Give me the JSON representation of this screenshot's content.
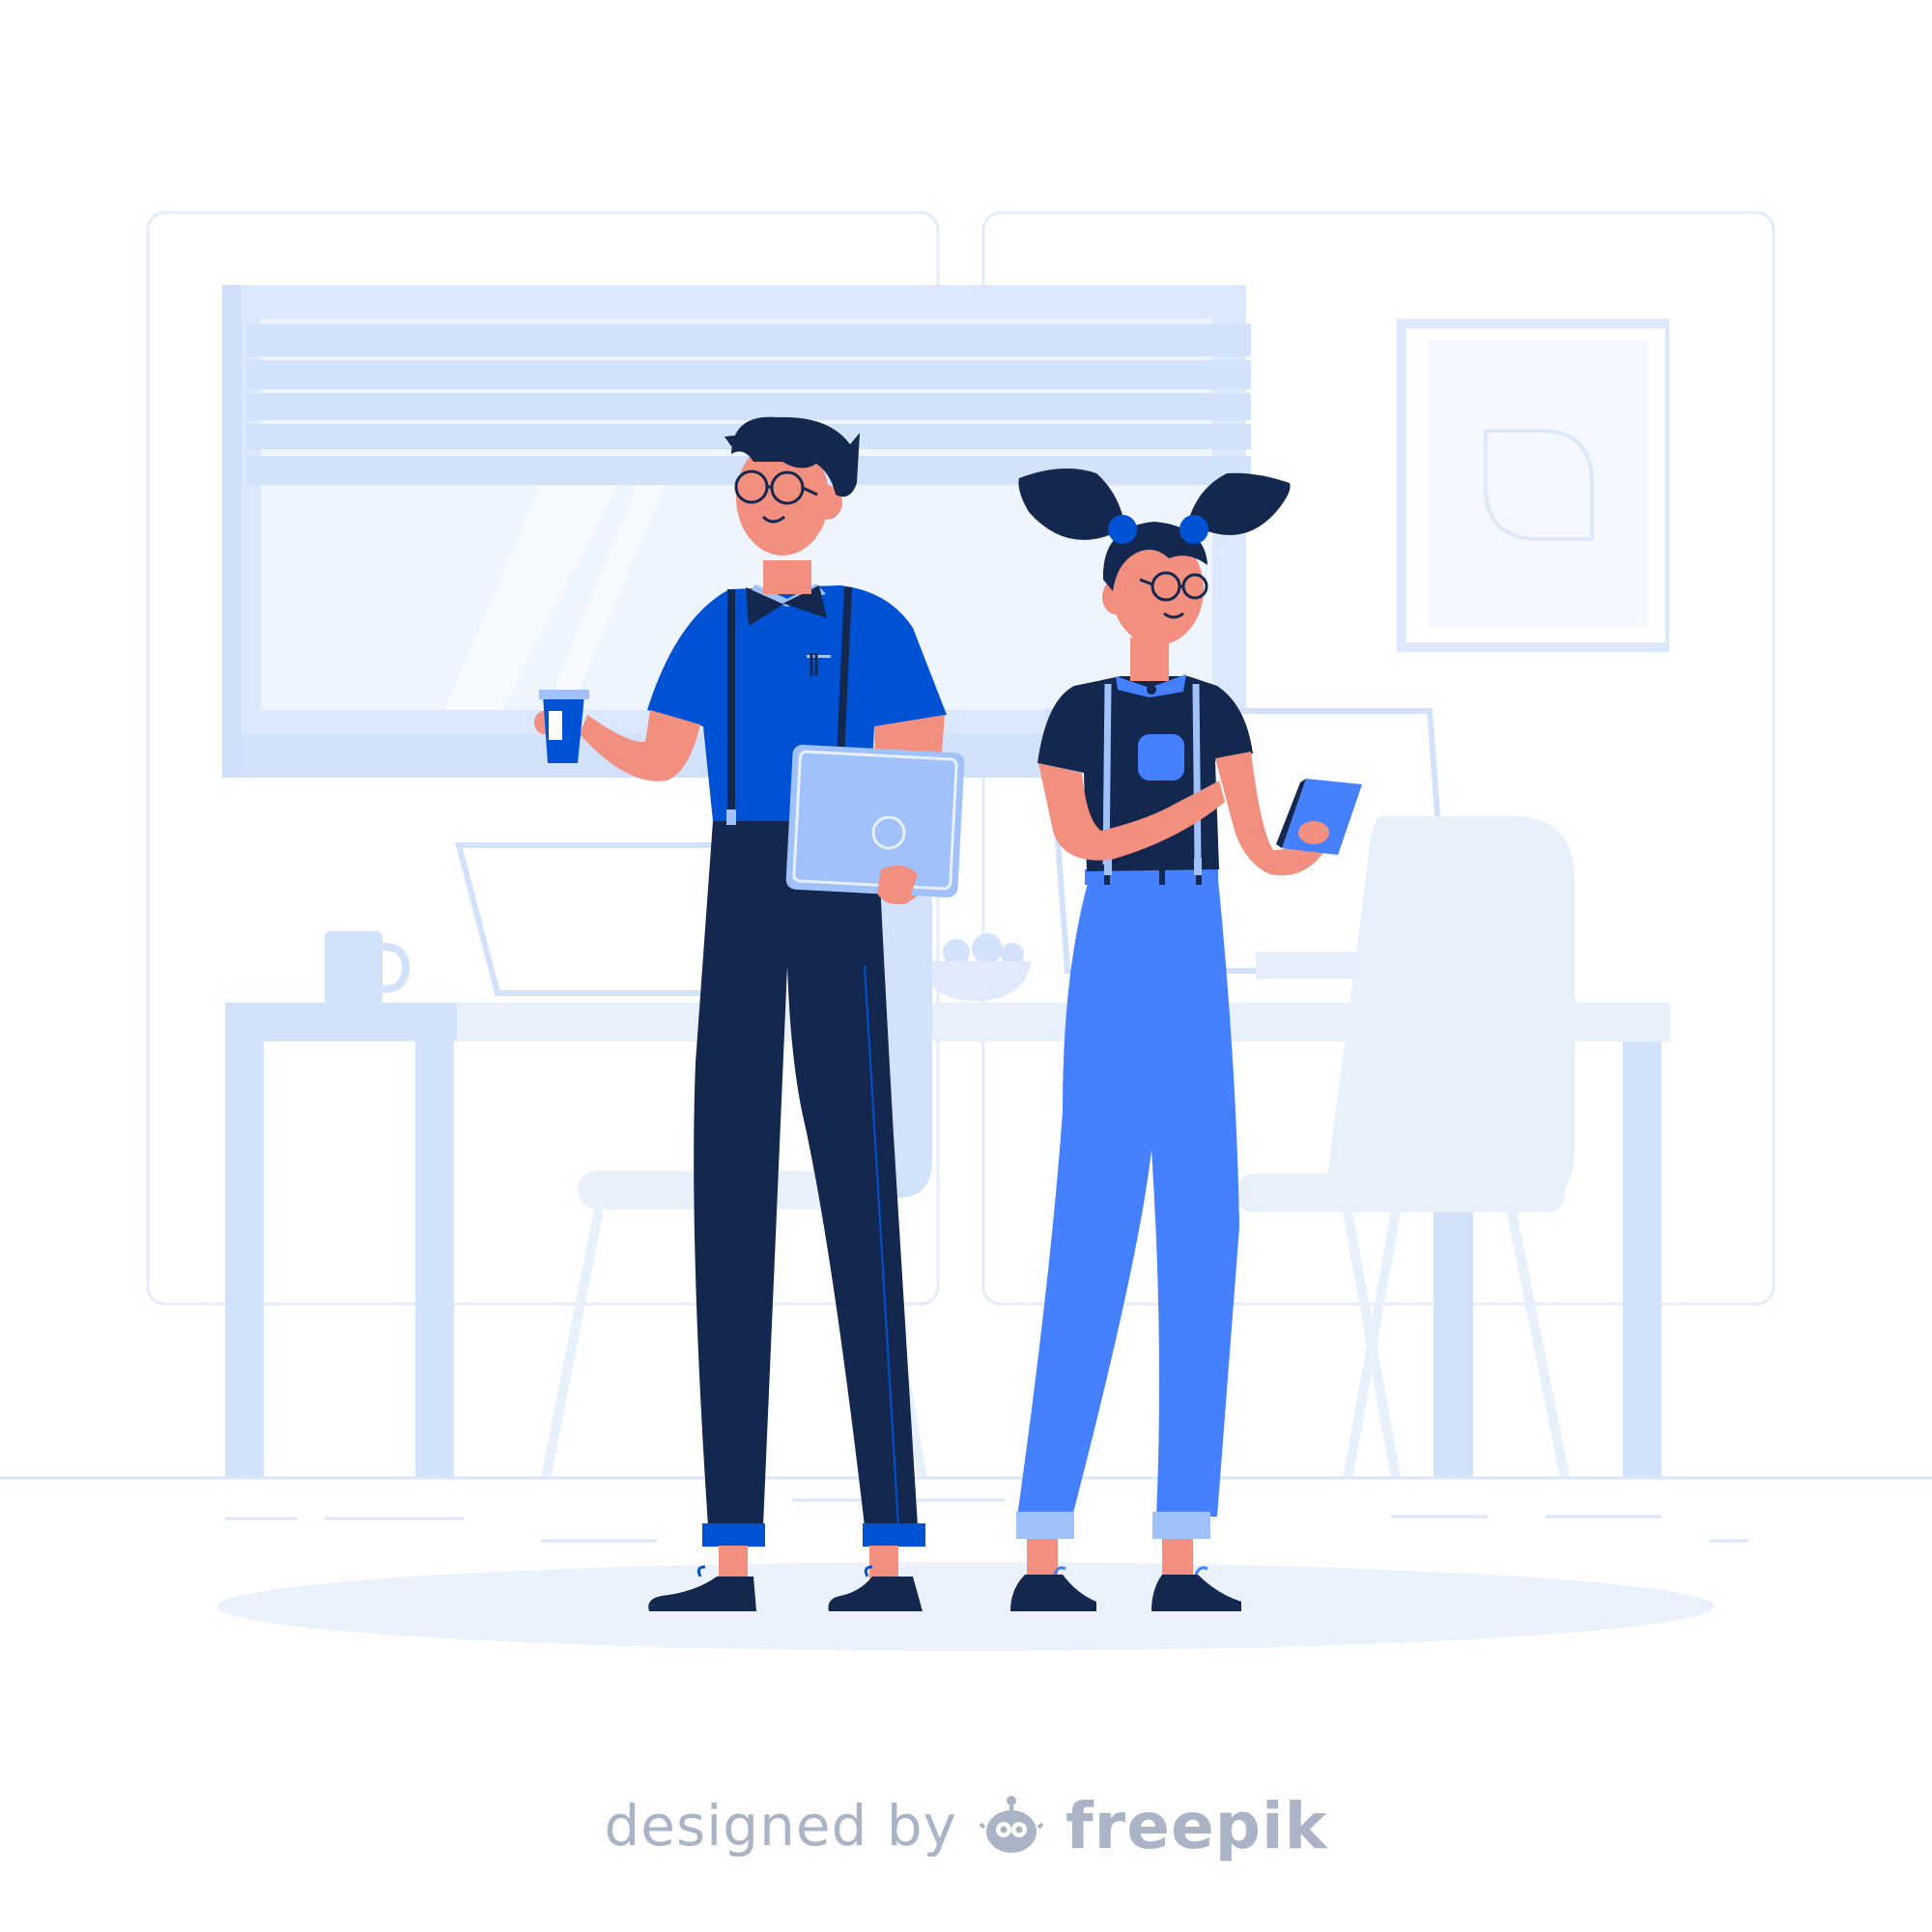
{
  "credit": {
    "prefix": "designed by",
    "brand": "freepik"
  },
  "palette": {
    "background": "#ffffff",
    "room_light": "#e8f0fc",
    "room_mid": "#d3e2fb",
    "room_line": "#dbe6f8",
    "navy": "#13274f",
    "royal_blue": "#0052d4",
    "mid_blue": "#4480ff",
    "light_blue": "#a0c1fa",
    "skin": "#f28f7e",
    "credit_gray": "#aab4c6"
  },
  "icons": [
    "freepik-logo-icon"
  ]
}
